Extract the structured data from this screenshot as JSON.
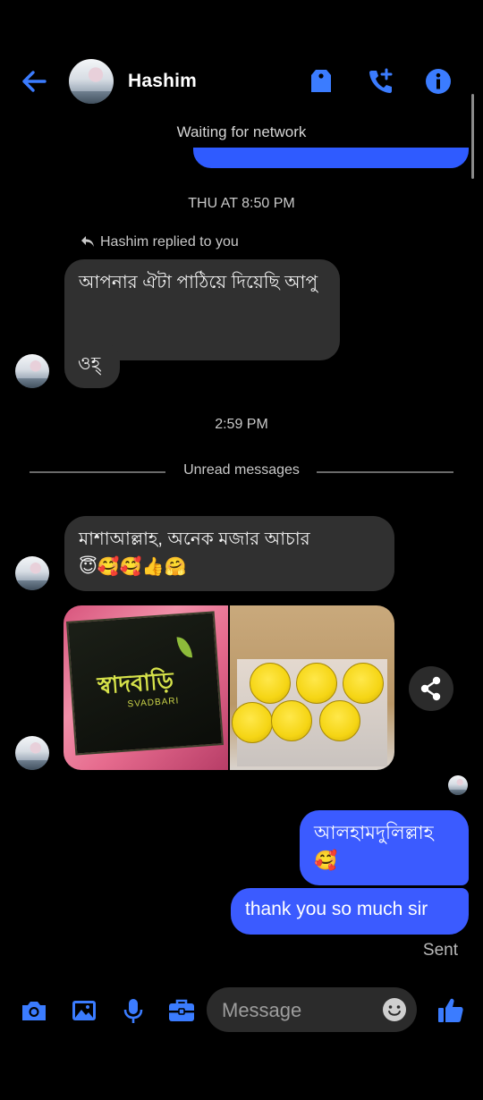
{
  "header": {
    "title": "Hashim",
    "status": "Waiting for network"
  },
  "conversation": {
    "timestamp_1": "THU AT 8:50 PM",
    "replied_notice": "Hashim replied to you",
    "reply_message": "আপনার ঐটা পাঠিয়ে দিয়েছি আপু",
    "message_2": "ওহ্",
    "timestamp_2": "2:59 PM",
    "unread_divider": "Unread messages",
    "message_3": "মাশাআল্লাহ, অনেক মজার আচার",
    "message_3_emojis": "😇🥰🥰👍🤗",
    "photo_1_brand": "স্বাদবাড়ি",
    "photo_1_sub": "SVADBARI",
    "my_message_1": "আলহামদুলিল্লাহ",
    "my_message_1_emoji": "🥰",
    "my_message_2": "thank you so much sir",
    "delivery_status": "Sent"
  },
  "composer": {
    "placeholder": "Message"
  },
  "icons": {
    "back": "arrow-left-icon",
    "tag": "tag-icon",
    "add_call": "phone-plus-icon",
    "info": "info-icon",
    "share": "share-icon",
    "camera": "camera-icon",
    "gallery": "image-icon",
    "mic": "microphone-icon",
    "briefcase": "briefcase-icon",
    "emoji": "smiley-icon",
    "like": "thumbs-up-icon"
  },
  "colors": {
    "accent": "#3b5bff",
    "background": "#000000",
    "incoming_bubble": "#303030"
  }
}
